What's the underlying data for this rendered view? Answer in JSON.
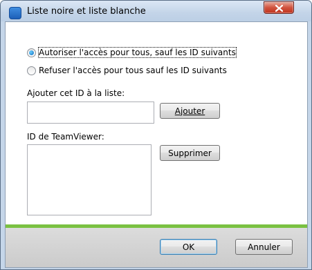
{
  "window": {
    "title": "Liste noire et liste blanche"
  },
  "options": {
    "allow_label": "Autoriser l'accès pour tous, sauf les ID suivants",
    "deny_label": "Refuser l'accès pour tous sauf les ID suivants",
    "selected": "allow"
  },
  "add": {
    "label": "Ajouter cet ID à la liste:",
    "input_value": "",
    "button_label": "Ajouter"
  },
  "list": {
    "label": "ID de TeamViewer:",
    "items": [],
    "remove_button_label": "Supprimer"
  },
  "footer": {
    "ok_label": "OK",
    "cancel_label": "Annuler"
  },
  "colors": {
    "accent_green": "#7ac142",
    "title_bar": "#c5d6e9",
    "close_button": "#c0331e"
  },
  "icons": [
    "teamviewer-app-icon",
    "close-icon"
  ]
}
